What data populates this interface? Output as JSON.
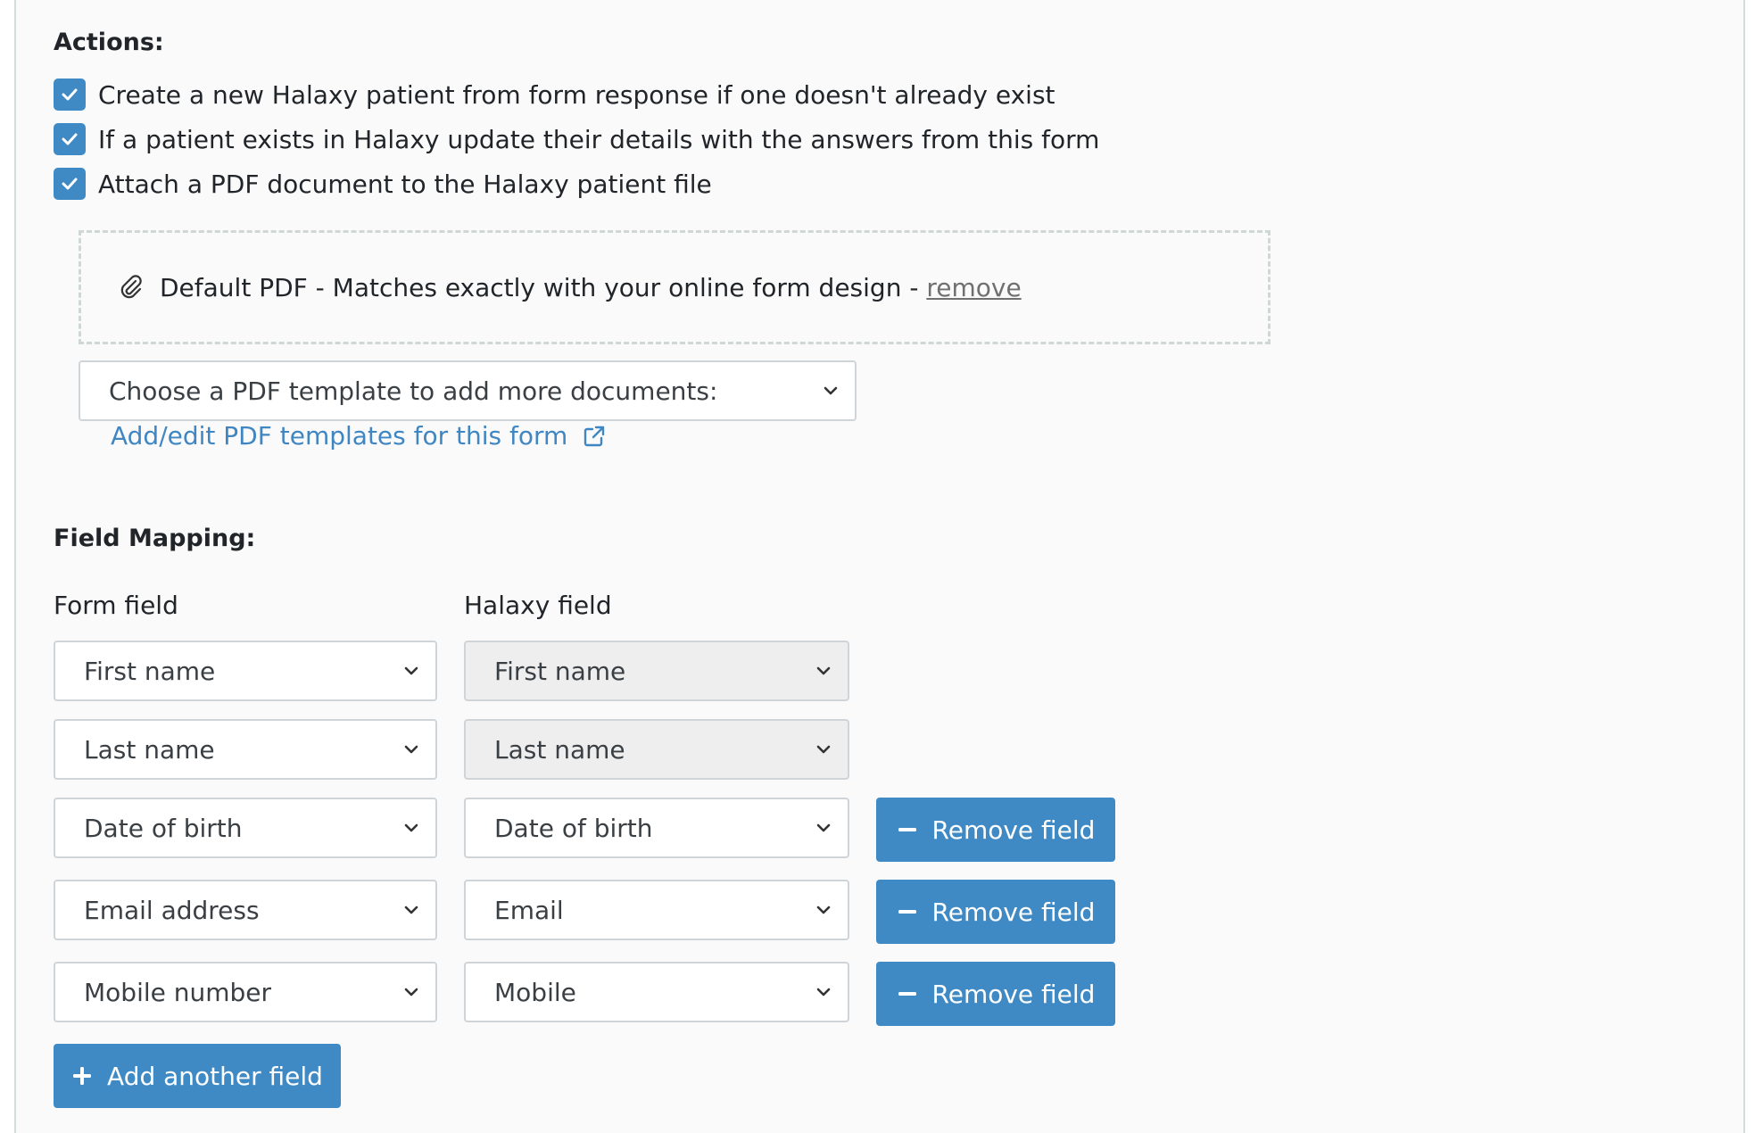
{
  "colors": {
    "accent": "#3f8ac4",
    "link": "#3f86c2",
    "border": "#cfd4d8",
    "disabled_bg": "#eeeeee"
  },
  "actions": {
    "title": "Actions:",
    "options": [
      {
        "label": "Create a new Halaxy patient from form response if one doesn't already exist",
        "checked": true
      },
      {
        "label": "If a patient exists in Halaxy update their details with the answers from this form",
        "checked": true
      },
      {
        "label": "Attach a PDF document to the Halaxy patient file",
        "checked": true
      }
    ],
    "pdf": {
      "icon": "paperclip-icon",
      "text": "Default PDF - Matches exactly with your online form design - ",
      "remove_label": "remove"
    },
    "template_select": {
      "value": "Choose a PDF template to add more documents:"
    },
    "template_link": {
      "label": "Add/edit PDF templates for this form",
      "icon": "external-link-icon"
    }
  },
  "field_mapping": {
    "title": "Field Mapping:",
    "col_form": "Form field",
    "col_halaxy": "Halaxy field",
    "rows": [
      {
        "form": "First name",
        "halaxy": "First name",
        "halaxy_disabled": true,
        "removable": false
      },
      {
        "form": "Last name",
        "halaxy": "Last name",
        "halaxy_disabled": true,
        "removable": false
      },
      {
        "form": "Date of birth",
        "halaxy": "Date of birth",
        "halaxy_disabled": false,
        "removable": true
      },
      {
        "form": "Email address",
        "halaxy": "Email",
        "halaxy_disabled": false,
        "removable": true
      },
      {
        "form": "Mobile number",
        "halaxy": "Mobile",
        "halaxy_disabled": false,
        "removable": true
      }
    ],
    "remove_label": "Remove field",
    "add_label": "Add another field"
  }
}
